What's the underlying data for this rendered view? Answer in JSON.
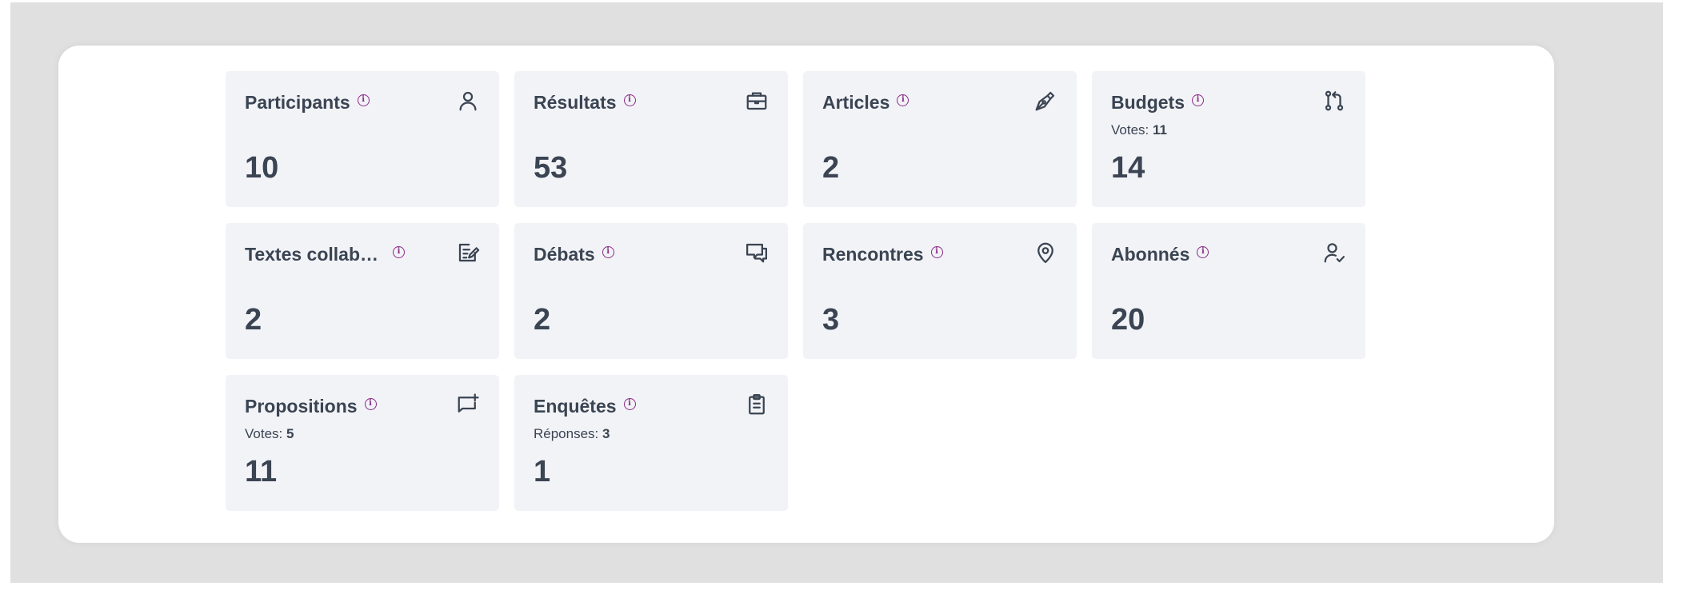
{
  "stats": [
    {
      "title": "Participants",
      "value": "10",
      "icon": "user-icon"
    },
    {
      "title": "Résultats",
      "value": "53",
      "icon": "briefcase-icon"
    },
    {
      "title": "Articles",
      "value": "2",
      "icon": "pen-nib-icon"
    },
    {
      "title": "Budgets",
      "value": "14",
      "icon": "git-pull-request-icon",
      "sub_label": "Votes:",
      "sub_value": "11"
    },
    {
      "title": "Textes collab…",
      "value": "2",
      "icon": "edit-document-icon"
    },
    {
      "title": "Débats",
      "value": "2",
      "icon": "chat-bubbles-icon"
    },
    {
      "title": "Rencontres",
      "value": "3",
      "icon": "map-pin-icon"
    },
    {
      "title": "Abonnés",
      "value": "20",
      "icon": "user-check-icon"
    },
    {
      "title": "Propositions",
      "value": "11",
      "icon": "chat-add-icon",
      "sub_label": "Votes:",
      "sub_value": "5"
    },
    {
      "title": "Enquêtes",
      "value": "1",
      "icon": "clipboard-icon",
      "sub_label": "Réponses:",
      "sub_value": "3"
    }
  ],
  "info_glyph": "i"
}
